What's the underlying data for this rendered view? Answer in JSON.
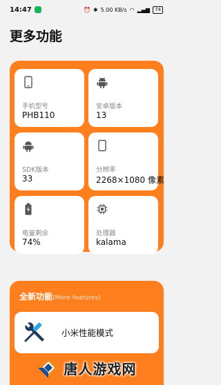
{
  "status_bar": {
    "time": "14:47",
    "network_speed": "5.00 KB/s",
    "battery": "74"
  },
  "page": {
    "title": "更多功能"
  },
  "device_info": {
    "cards": [
      {
        "label": "手机型号",
        "value": "PHB110",
        "icon": "phone-icon"
      },
      {
        "label": "安卓版本",
        "value": "13",
        "icon": "android-icon"
      },
      {
        "label": "SDK版本",
        "value": "33",
        "icon": "android-icon"
      },
      {
        "label": "分辨率",
        "value": "2268×1080 像素",
        "icon": "screen-icon"
      },
      {
        "label": "电量剩余",
        "value": "74%",
        "icon": "battery-icon"
      },
      {
        "label": "处理器",
        "value": "kalama",
        "icon": "chip-icon"
      }
    ]
  },
  "features": {
    "title": "全新功能",
    "subtitle": "(More features)",
    "items": [
      {
        "label": "小米性能模式",
        "icon": "tools-icon"
      }
    ]
  },
  "watermark": {
    "text": "唐人游戏网"
  },
  "colors": {
    "accent": "#ff7f1e",
    "background": "#f2f2f2",
    "card": "#ffffff"
  }
}
